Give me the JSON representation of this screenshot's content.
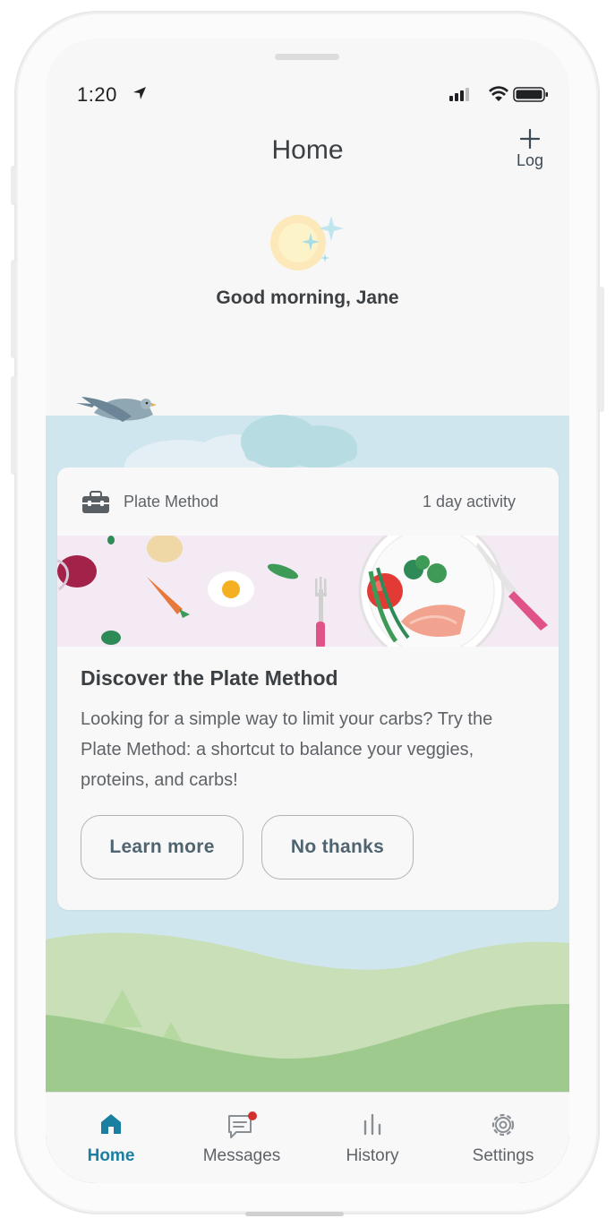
{
  "status_bar": {
    "time": "1:20"
  },
  "header": {
    "title": "Home",
    "log_label": "Log"
  },
  "greeting": {
    "text": "Good morning, Jane"
  },
  "card": {
    "category": "Plate Method",
    "activity": "1 day activity",
    "title": "Discover the Plate Method",
    "body": "Looking for a simple way to limit your carbs? Try the Plate Method: a shortcut to balance your veggies, proteins, and carbs!",
    "primary_button": "Learn more",
    "secondary_button": "No thanks"
  },
  "tabs": [
    {
      "label": "Home",
      "icon": "home-icon",
      "active": true
    },
    {
      "label": "Messages",
      "icon": "messages-icon",
      "badge": true
    },
    {
      "label": "History",
      "icon": "history-icon"
    },
    {
      "label": "Settings",
      "icon": "settings-icon"
    }
  ],
  "colors": {
    "accent": "#1a7fa0",
    "sky": "#d0e6ee",
    "hills": "#9fca8e",
    "badge": "#d32f2f"
  }
}
